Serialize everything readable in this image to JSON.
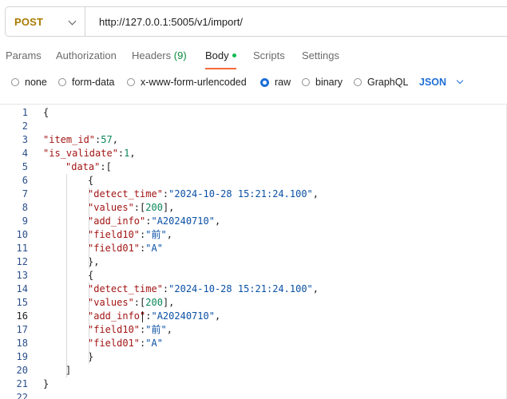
{
  "request": {
    "method": "POST",
    "url": "http://127.0.0.1:5005/v1/import/"
  },
  "tabs": [
    {
      "label": "Params"
    },
    {
      "label": "Authorization"
    },
    {
      "label": "Headers",
      "count": "(9)"
    },
    {
      "label": "Body",
      "active": true
    },
    {
      "label": "Scripts"
    },
    {
      "label": "Settings"
    }
  ],
  "body_types": [
    {
      "label": "none",
      "checked": false
    },
    {
      "label": "form-data",
      "checked": false
    },
    {
      "label": "x-www-form-urlencoded",
      "checked": false
    },
    {
      "label": "raw",
      "checked": true
    },
    {
      "label": "binary",
      "checked": false
    },
    {
      "label": "GraphQL",
      "checked": false
    }
  ],
  "format": "JSON",
  "colors": {
    "method": "#a77a00",
    "accent_underline": "#f26b3a",
    "body_dot": "#0cbb52",
    "radio_checked": "#1d6ed6",
    "json_key": "#a31515",
    "json_string": "#0a50a5",
    "json_number": "#098658"
  },
  "editor": {
    "current_line": "16",
    "lines": [
      {
        "n": "1",
        "text": "{"
      },
      {
        "n": "2",
        "text": ""
      },
      {
        "n": "3",
        "text": "\"item_id\":57,"
      },
      {
        "n": "4",
        "text": "\"is_validate\":1,"
      },
      {
        "n": "5",
        "text": "\"data\":["
      },
      {
        "n": "6",
        "text": "{"
      },
      {
        "n": "7",
        "text": "\"detect_time\":\"2024-10-28 15:21:24.100\","
      },
      {
        "n": "8",
        "text": "\"values\":[200],"
      },
      {
        "n": "9",
        "text": "\"add_info\":\"A20240710\","
      },
      {
        "n": "10",
        "text": "\"field10\":\"前\","
      },
      {
        "n": "11",
        "text": "\"field01\":\"A\""
      },
      {
        "n": "12",
        "text": "},"
      },
      {
        "n": "13",
        "text": "{"
      },
      {
        "n": "14",
        "text": "\"detect_time\":\"2024-10-28 15:21:24.100\","
      },
      {
        "n": "15",
        "text": "\"values\":[200],"
      },
      {
        "n": "16",
        "text": "\"add_info\":\"A20240710\","
      },
      {
        "n": "17",
        "text": "\"field10\":\"前\","
      },
      {
        "n": "18",
        "text": "\"field01\":\"A\""
      },
      {
        "n": "19",
        "text": "}"
      },
      {
        "n": "20",
        "text": "]"
      },
      {
        "n": "21",
        "text": "}"
      },
      {
        "n": "22",
        "text": ""
      }
    ]
  }
}
